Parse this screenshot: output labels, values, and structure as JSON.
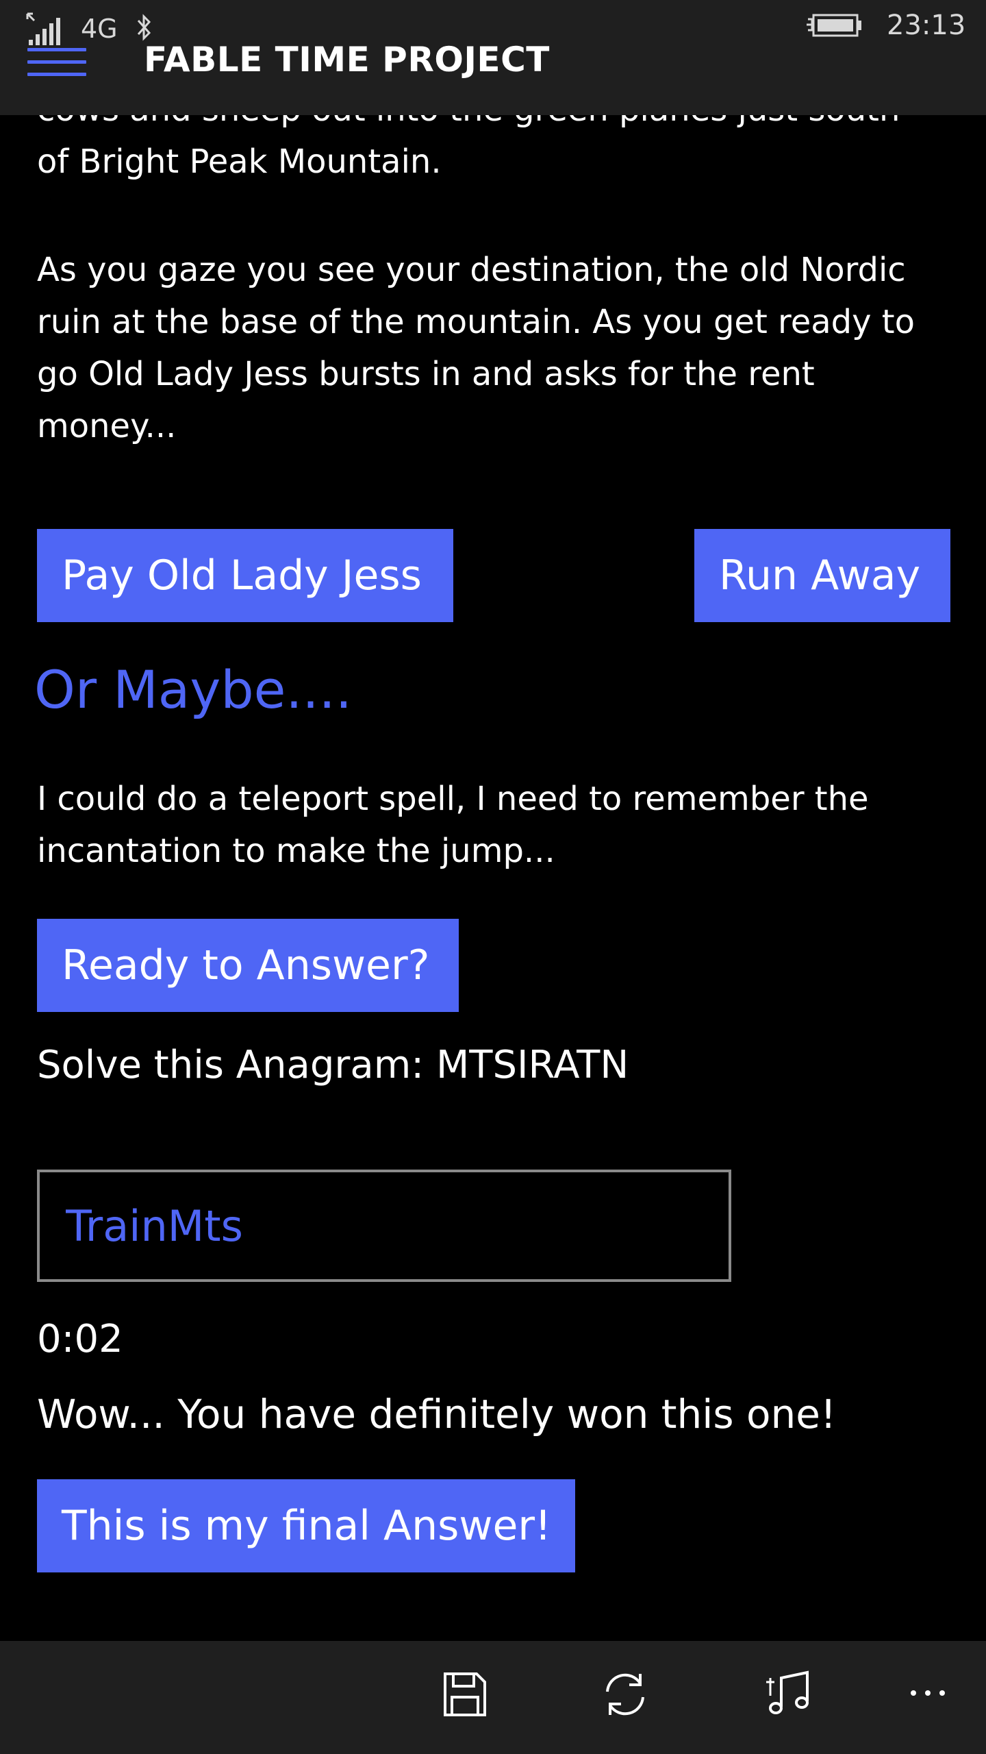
{
  "status_bar": {
    "network": "4G",
    "time": "23:13"
  },
  "header": {
    "title": "FABLE TIME PROJECT"
  },
  "story": {
    "cut_line": "cows and sheep out into the green planes just south",
    "paragraph1_end": "of Bright Peak Mountain.",
    "paragraph2": "As you gaze you see your destination, the old Nordic ruin at the base of the mountain. As you get ready to go Old Lady Jess bursts in and asks for the rent money..."
  },
  "choices": {
    "pay_label": "Pay Old Lady Jess",
    "run_label": "Run Away"
  },
  "alternative": {
    "heading": "Or Maybe....",
    "text": "I could do a teleport spell, I need to remember the incantation to make the jump...",
    "ready_label": "Ready to Answer?"
  },
  "puzzle": {
    "prompt": "Solve this Anagram: MTSIRATN",
    "answer_value": "TrainMts",
    "timer": "0:02",
    "result": "Wow... You have definitely won this one!",
    "final_label": "This is my final Answer!"
  },
  "app_bar": {
    "icons": [
      "save-icon",
      "sync-icon",
      "music-icon",
      "more-icon"
    ]
  },
  "colors": {
    "accent": "#4f66f5",
    "bar": "#1f1f1f",
    "background": "#000000",
    "text": "#ffffff"
  }
}
